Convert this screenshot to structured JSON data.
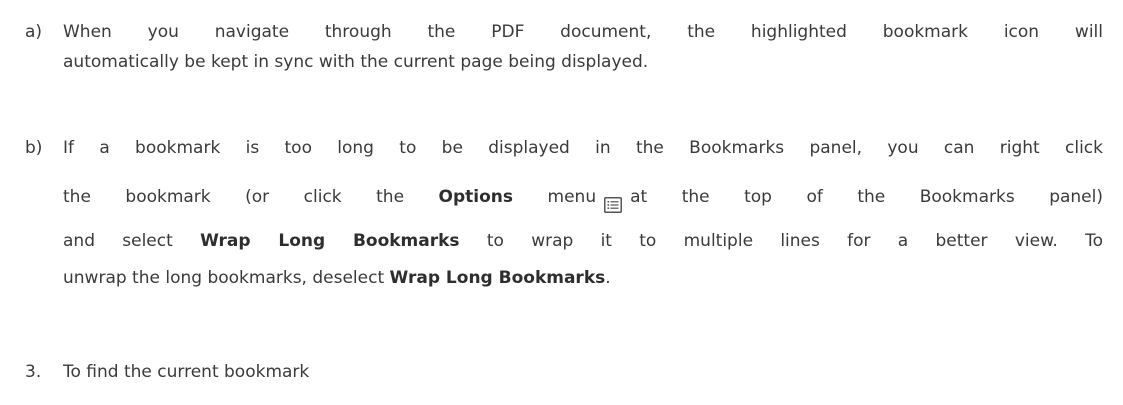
{
  "item_a": {
    "marker": "a)",
    "line1": "When you navigate through the PDF document, the highlighted bookmark icon will",
    "line2": "automatically be kept in sync with the current page being displayed."
  },
  "item_b": {
    "marker": "b)",
    "line1": "If a bookmark is too long to be displayed in the Bookmarks panel, you can right click",
    "line2_pre": "the bookmark (or click the ",
    "line2_bold": "Options",
    "line2_mid": " menu",
    "line2_post": "at the top of the Bookmarks panel)",
    "line3_pre": "and select ",
    "line3_bold": "Wrap Long Bookmarks",
    "line3_post": " to wrap it to multiple lines for a better view. To",
    "line4_pre": "unwrap the long bookmarks, deselect ",
    "line4_bold": "Wrap Long Bookmarks",
    "line4_post": ".",
    "icon": "options-menu-icon"
  },
  "item_3": {
    "marker": "3.",
    "text": "To find the current bookmark"
  }
}
